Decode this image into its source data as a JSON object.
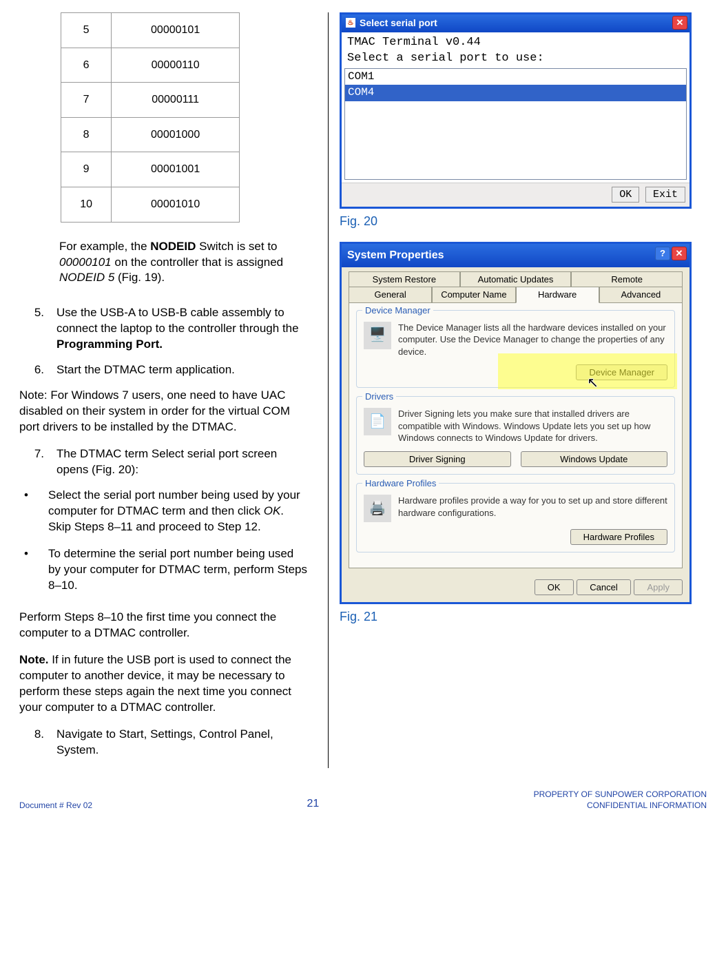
{
  "table": {
    "rows": [
      {
        "id": "5",
        "val": "00000101"
      },
      {
        "id": "6",
        "val": "00000110"
      },
      {
        "id": "7",
        "val": "00000111"
      },
      {
        "id": "8",
        "val": "00001000"
      },
      {
        "id": "9",
        "val": "00001001"
      },
      {
        "id": "10",
        "val": "00001010"
      }
    ]
  },
  "example_para": {
    "pre": "For example, the ",
    "b1": "NODEID",
    "mid1": " Switch is set to ",
    "i1": "00000101",
    "mid2": " on the controller that is assigned ",
    "i2": "NODEID 5",
    "post": " (Fig. 19)."
  },
  "steps": {
    "s5_num": "5.",
    "s5_a": "Use the USB-A to USB-B cable assembly to connect the laptop to the controller through the ",
    "s5_b": "Programming Port.",
    "s6_num": "6.",
    "s6": "Start the DTMAC term application.",
    "noteA": "Note: For Windows 7 users, one need to have UAC disabled on their system in order for the virtual COM port drivers to be installed by the DTMAC.",
    "s7_num": "7.",
    "s7": "The DTMAC term Select serial port screen opens (Fig. 20):",
    "bullet1_a": "Select the serial port number being used by your computer for DTMAC term and then click ",
    "bullet1_ok": "OK",
    "bullet1_b": ". Skip Steps 8–11 and proceed to Step 12.",
    "bullet2": "To determine the serial port number being used by your computer for DTMAC term, perform Steps 8–10.",
    "perform": "Perform Steps 8–10 the first time you connect the computer to a DTMAC controller.",
    "noteB_lead": "Note.",
    "noteB": " If in future the USB port is used to connect the computer to another device, it may be necessary to perform these steps again the next time you connect your computer to a DTMAC controller.",
    "s8_num": "8.",
    "s8": "Navigate to Start, Settings, Control Panel, System."
  },
  "fig20": {
    "caption": "Fig. 20",
    "title": "Select serial port",
    "term_line1": "TMAC Terminal v0.44",
    "term_line2": "Select a serial port to use:",
    "items": [
      "COM1",
      "COM4"
    ],
    "selected_index": 1,
    "ok": "OK",
    "exit": "Exit"
  },
  "fig21": {
    "caption": "Fig. 21",
    "title": "System Properties",
    "tabs_row1": [
      "System Restore",
      "Automatic Updates",
      "Remote"
    ],
    "tabs_row2": [
      "General",
      "Computer Name",
      "Hardware",
      "Advanced"
    ],
    "active_tab": "Hardware",
    "dm_group": "Device Manager",
    "dm_text": "The Device Manager lists all the hardware devices installed on your computer. Use the Device Manager to change the properties of any device.",
    "dm_btn": "Device Manager",
    "drv_group": "Drivers",
    "drv_text": "Driver Signing lets you make sure that installed drivers are compatible with Windows. Windows Update lets you set up how Windows connects to Windows Update for drivers.",
    "drv_btn1": "Driver Signing",
    "drv_btn2": "Windows Update",
    "hw_group": "Hardware Profiles",
    "hw_text": "Hardware profiles provide a way for you to set up and store different hardware configurations.",
    "hw_btn": "Hardware Profiles",
    "ok": "OK",
    "cancel": "Cancel",
    "apply": "Apply"
  },
  "footer": {
    "left": "Document # Rev 02",
    "page": "21",
    "right1": "PROPERTY OF SUNPOWER CORPORATION",
    "right2": "CONFIDENTIAL INFORMATION"
  }
}
